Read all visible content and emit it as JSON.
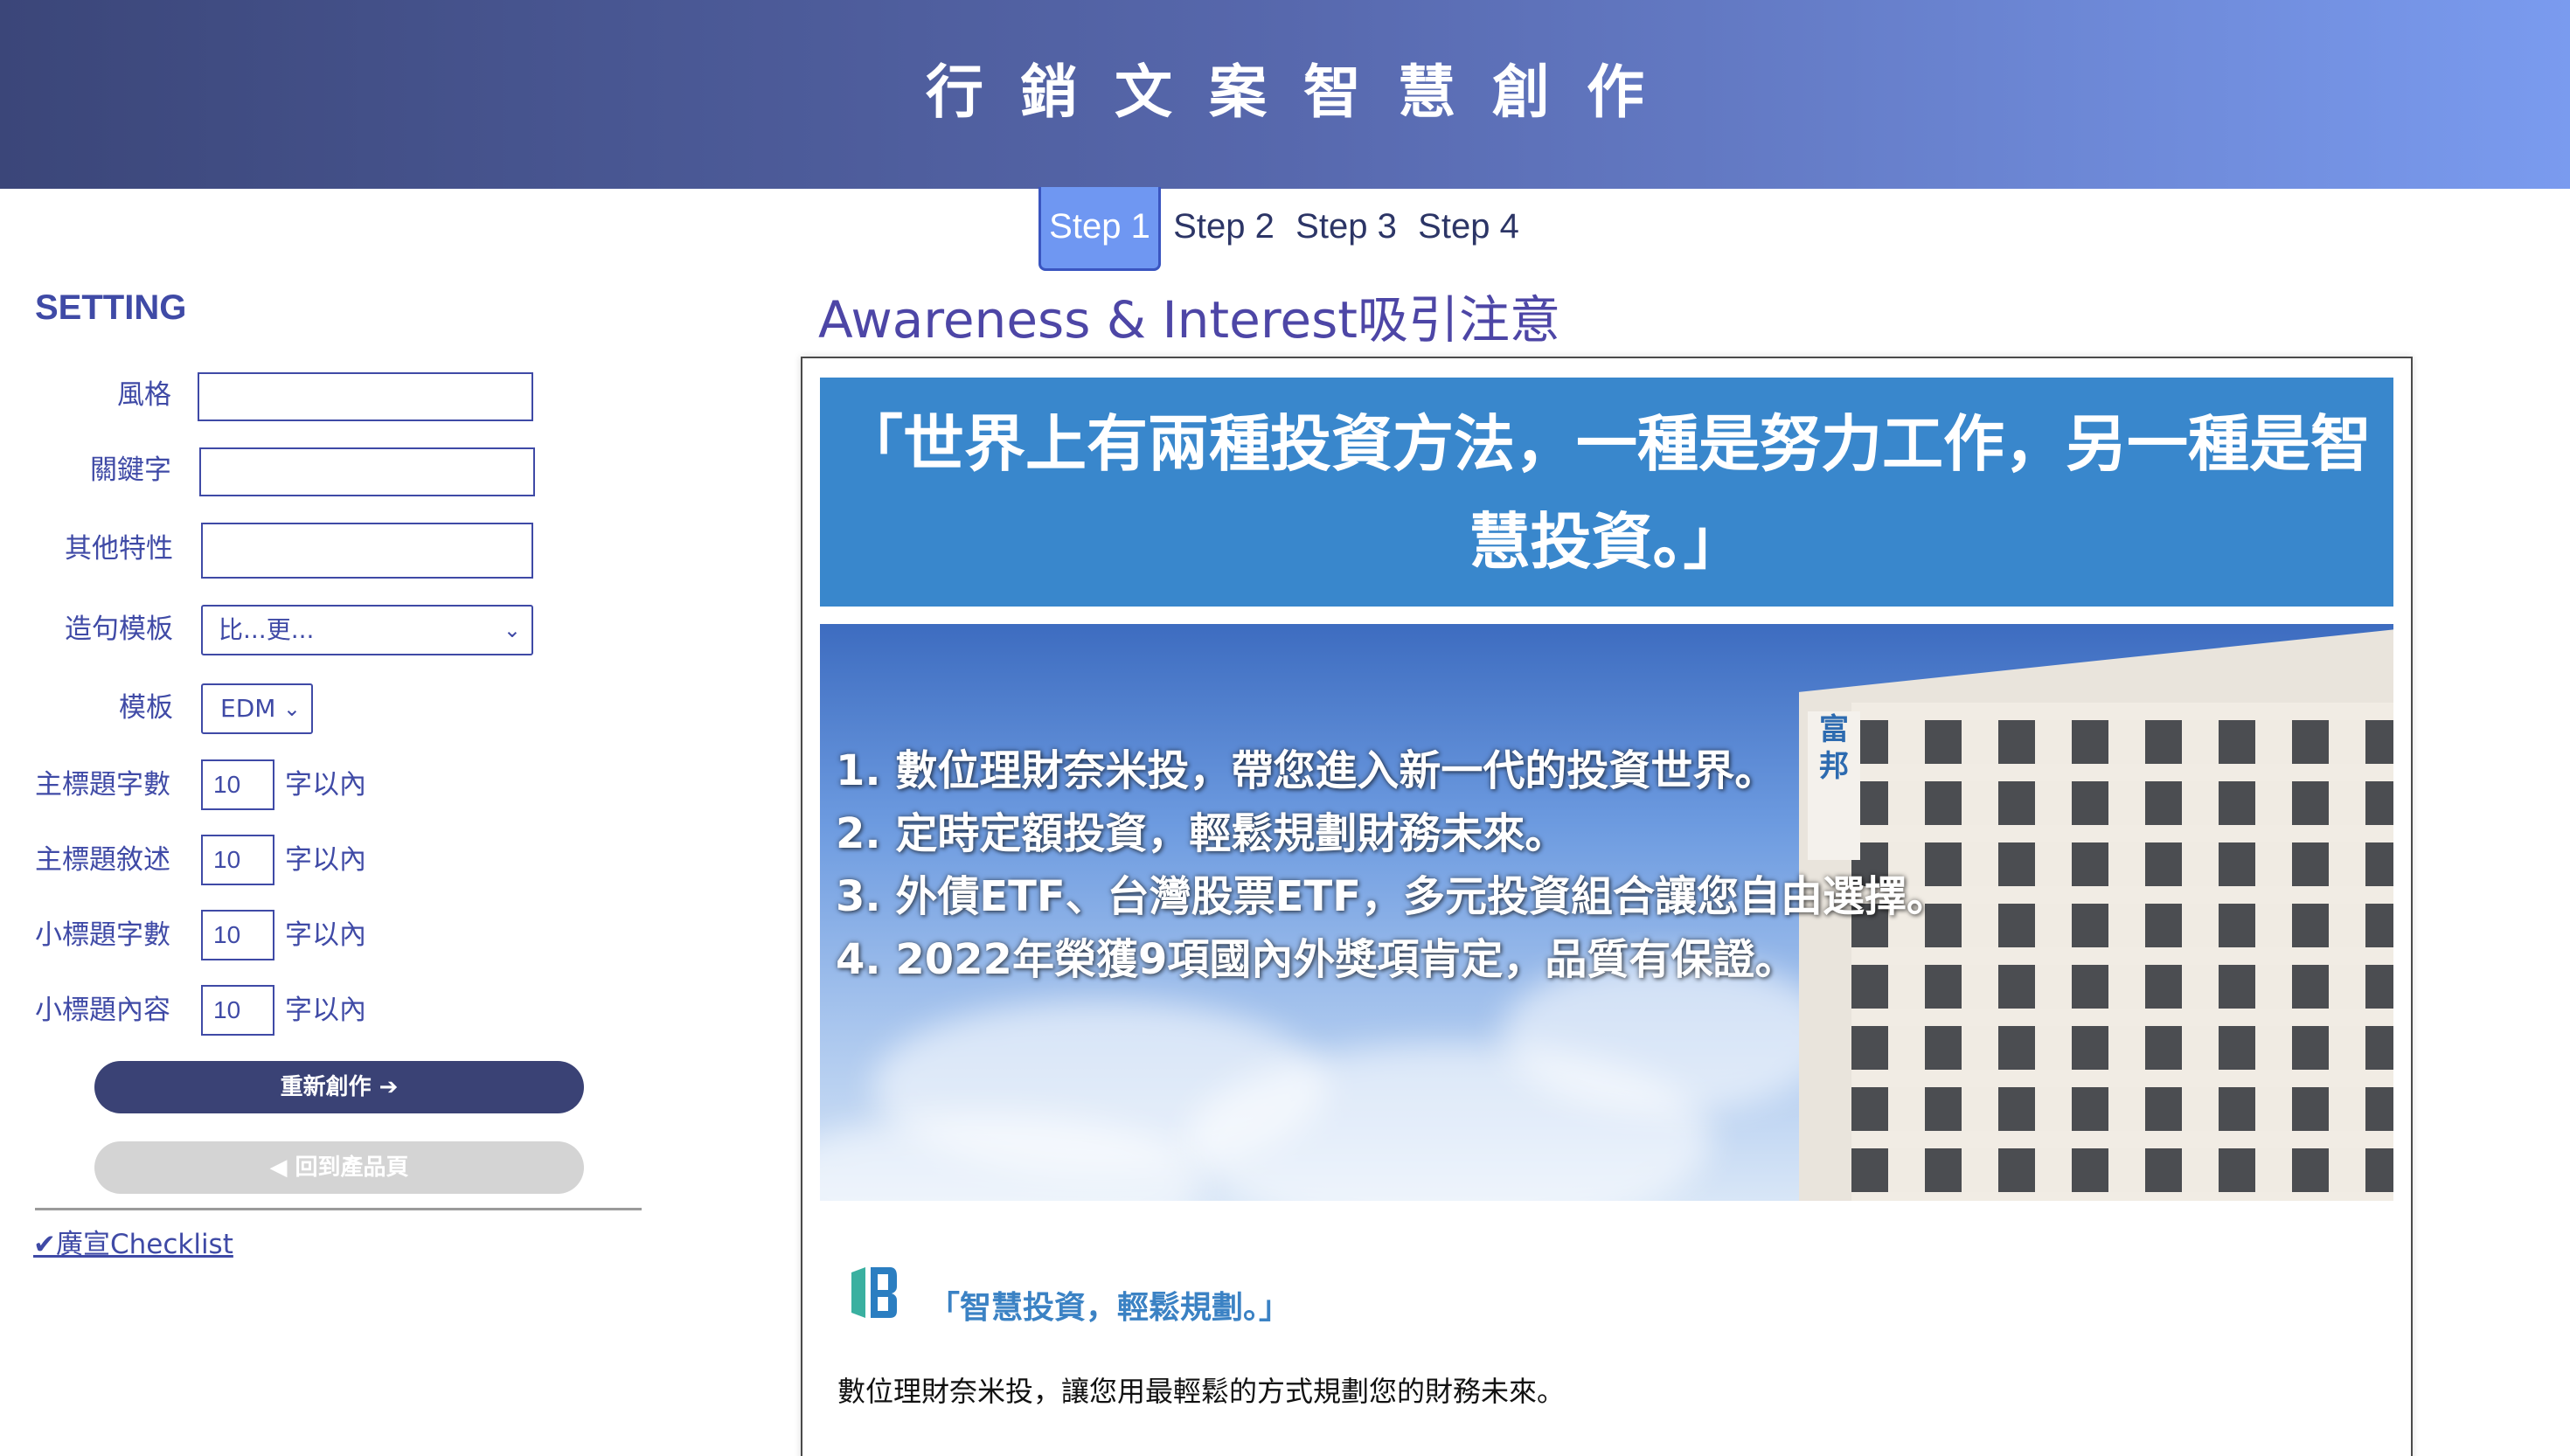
{
  "header": {
    "title": "行銷文案智慧創作"
  },
  "steps": [
    {
      "label": "Step 1",
      "active": true
    },
    {
      "label": "Step 2",
      "active": false
    },
    {
      "label": "Step 3",
      "active": false
    },
    {
      "label": "Step 4",
      "active": false
    }
  ],
  "sidebar": {
    "title": "SETTING",
    "fields": {
      "style": {
        "label": "風格",
        "value": ""
      },
      "keyword": {
        "label": "關鍵字",
        "value": ""
      },
      "other": {
        "label": "其他特性",
        "value": ""
      },
      "sentence_template": {
        "label": "造句模板",
        "selected": "比...更..."
      },
      "template": {
        "label": "模板",
        "selected": "EDM"
      },
      "main_title_chars": {
        "label": "主標題字數",
        "value": "10",
        "suffix": "字以內"
      },
      "main_title_desc": {
        "label": "主標題敘述",
        "value": "10",
        "suffix": "字以內"
      },
      "sub_title_chars": {
        "label": "小標題字數",
        "value": "10",
        "suffix": "字以內"
      },
      "sub_title_content": {
        "label": "小標題內容",
        "value": "10",
        "suffix": "字以內"
      }
    },
    "regenerate_button": "重新創作 ➔",
    "back_button": "◀ 回到產品頁",
    "checklist_link": "✔廣宣Checklist"
  },
  "main": {
    "section_title": "Awareness & Interest吸引注意",
    "headline": "「世界上有兩種投資方法，一種是努力工作，另一種是智慧投資。」",
    "hero": {
      "sign_text": "富邦",
      "bullets": [
        "1. 數位理財奈米投，帶您進入新一代的投資世界。",
        "2. 定時定額投資，輕鬆規劃財務未來。",
        "3. 外債ETF、台灣股票ETF，多元投資組合讓您自由選擇。",
        "4. 2022年榮獲9項國內外獎項肯定，品質有保證。"
      ]
    },
    "slogan": "「智慧投資，輕鬆規劃。」",
    "body": "數位理財奈米投，讓您用最輕鬆的方式規劃您的財務未來。"
  },
  "colors": {
    "header_gradient_start": "#3b4679",
    "header_gradient_end": "#7a9bef",
    "accent": "#3f4aa6",
    "active_step": "#6f97f2",
    "headline_bg": "#3987cc",
    "primary_button": "#3a4275",
    "secondary_button": "#d4d4d4"
  }
}
